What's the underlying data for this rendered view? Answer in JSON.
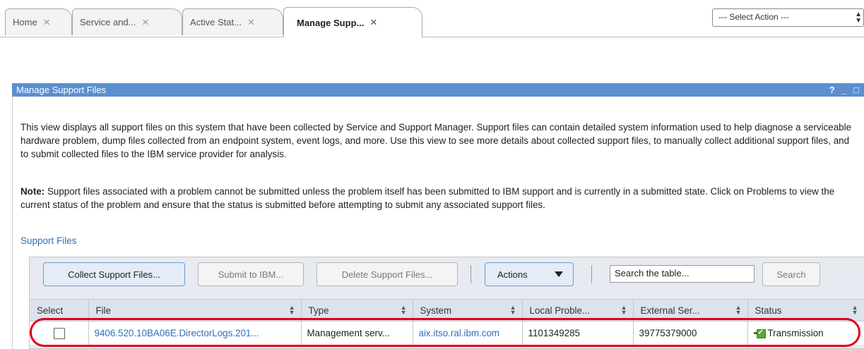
{
  "tabs": [
    {
      "label": "Home",
      "close": "✕"
    },
    {
      "label": "Service and...",
      "close": "✕"
    },
    {
      "label": "Active Stat...",
      "close": "✕"
    },
    {
      "label": "Manage Supp...",
      "close": "✕",
      "active": true
    }
  ],
  "select_action": {
    "label": "--- Select Action ---"
  },
  "panel": {
    "title": "Manage Support Files",
    "controls": "? _ □",
    "description": "This view displays all support files on this system that have been collected by Service and Support Manager. Support files can contain detailed system information used to help diagnose a serviceable hardware problem, dump files collected from an endpoint system, event logs, and more. Use this view to see more details about collected support files, to manually collect additional support files, and to submit collected files to the IBM service provider for analysis.",
    "note_label": "Note:",
    "note_text": " Support files associated with a problem cannot be submitted unless the problem itself has been submitted to IBM support and is currently in a submitted state. Click on Problems to view the current status of the problem and ensure that the status is submitted before attempting to submit any associated support files."
  },
  "section_link": "Support Files",
  "toolbar": {
    "collect_label": "Collect Support Files...",
    "submit_label": "Submit to IBM...",
    "delete_label": "Delete Support Files...",
    "actions_label": "Actions",
    "search_placeholder": "Search the table...",
    "search_button": "Search"
  },
  "table": {
    "columns": [
      "Select",
      "File",
      "Type",
      "System",
      "Local Proble...",
      "External Ser...",
      "Status"
    ],
    "rows": [
      {
        "file": "9406.520.10BA06E.DirectorLogs.201...",
        "type": "Management serv...",
        "system": "aix.itso.ral.ibm.com",
        "local_problem": "1101349285",
        "external_service": "39775379000",
        "status": "Transmission"
      }
    ]
  },
  "colors": {
    "header_blue": "#5b8fd0",
    "link_blue": "#2f6fb8",
    "highlight_red": "#e0001b",
    "status_green": "#5aa83a"
  }
}
